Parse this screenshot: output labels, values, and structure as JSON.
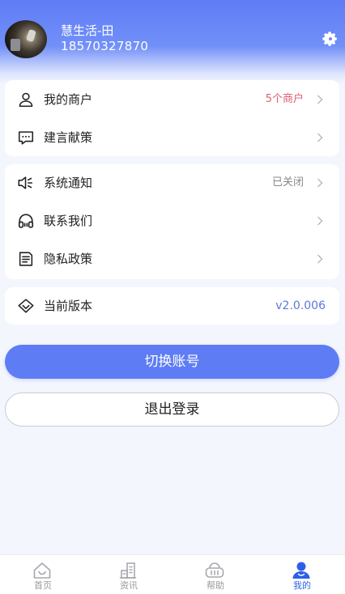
{
  "header": {
    "name": "慧生活-田",
    "phone": "18570327870",
    "settings_icon": "gear-icon"
  },
  "colors": {
    "accent": "#5e7cf4",
    "header_top": "#5f7cf6",
    "merchant_count": "#e05d6f",
    "version": "#5d78d8",
    "tab_active": "#2f5fe8"
  },
  "menu": {
    "merchants": {
      "label": "我的商户",
      "value": "5个商户",
      "icon": "user-icon"
    },
    "suggestions": {
      "label": "建言献策",
      "icon": "message-icon"
    },
    "notifications": {
      "label": "系统通知",
      "value": "已关闭",
      "icon": "speaker-icon"
    },
    "contact": {
      "label": "联系我们",
      "icon": "headset-icon"
    },
    "privacy": {
      "label": "隐私政策",
      "icon": "document-icon"
    },
    "version": {
      "label": "当前版本",
      "value": "v2.0.006",
      "icon": "diamond-icon"
    }
  },
  "buttons": {
    "switch_account": "切换账号",
    "logout": "退出登录"
  },
  "tabs": [
    {
      "label": "首页",
      "icon": "home-icon",
      "active": false
    },
    {
      "label": "资讯",
      "icon": "building-icon",
      "active": false
    },
    {
      "label": "帮助",
      "icon": "basket-icon",
      "active": false
    },
    {
      "label": "我的",
      "icon": "person-icon",
      "active": true
    }
  ]
}
